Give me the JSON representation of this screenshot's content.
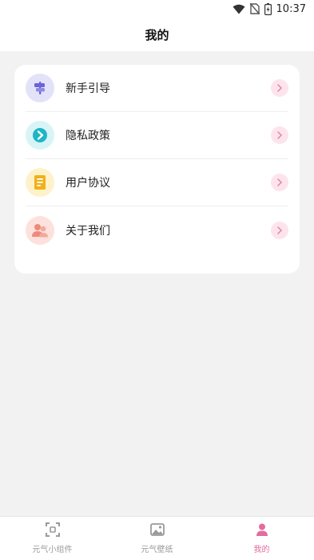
{
  "status_bar": {
    "time": "10:37"
  },
  "header": {
    "title": "我的"
  },
  "menu": {
    "items": [
      {
        "label": "新手引导",
        "icon": "signpost-icon",
        "icon_bg": "#e4e2f8",
        "icon_color": "#6b63d8"
      },
      {
        "label": "隐私政策",
        "icon": "privacy-icon",
        "icon_bg": "#d8f4f7",
        "icon_color": "#1fb5c6"
      },
      {
        "label": "用户协议",
        "icon": "document-icon",
        "icon_bg": "#fdf2c9",
        "icon_color": "#f2b01a"
      },
      {
        "label": "关于我们",
        "icon": "users-icon",
        "icon_bg": "#fde1dc",
        "icon_color": "#ee8a7a"
      }
    ]
  },
  "tabs": [
    {
      "label": "元气小组件",
      "icon": "widget-icon",
      "active": false
    },
    {
      "label": "元气壁纸",
      "icon": "image-icon",
      "active": false
    },
    {
      "label": "我的",
      "icon": "person-icon",
      "active": true
    }
  ],
  "colors": {
    "accent": "#e36c9f",
    "chevron_bg": "#fde4ec",
    "page_bg": "#f2f2f2"
  }
}
